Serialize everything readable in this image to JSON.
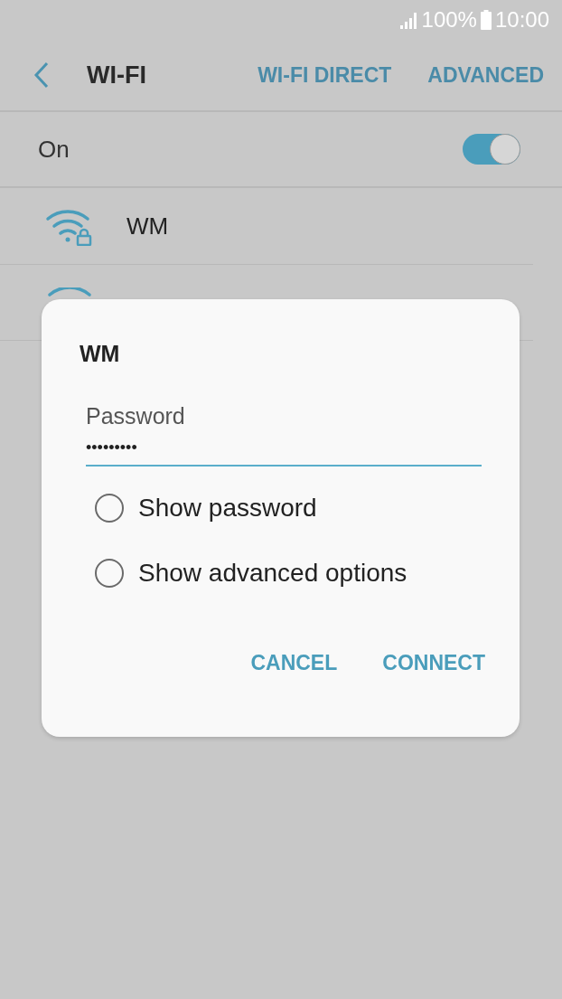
{
  "status_bar": {
    "battery": "100%",
    "time": "10:00"
  },
  "app_bar": {
    "title": "WI-FI",
    "actions": [
      "WI-FI DIRECT",
      "ADVANCED"
    ]
  },
  "master_switch": {
    "label": "On",
    "on": true
  },
  "networks": [
    {
      "name": "WM",
      "locked": true
    }
  ],
  "dialog": {
    "title": "WM",
    "field": {
      "label": "Password",
      "value": "•••••••••"
    },
    "options": [
      {
        "label": "Show password",
        "checked": false
      },
      {
        "label": "Show advanced options",
        "checked": false
      }
    ],
    "buttons": [
      "CANCEL",
      "CONNECT"
    ]
  }
}
